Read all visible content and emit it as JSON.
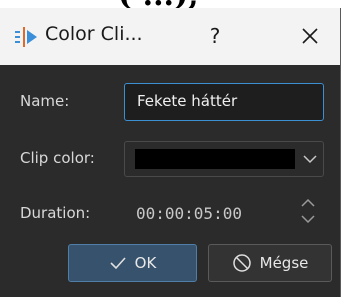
{
  "background_top_text": "(·...),",
  "dialog": {
    "title": "Color Cli...",
    "help_label": "?",
    "close_label": "✕"
  },
  "form": {
    "name_label": "Name:",
    "name_value": "Fekete háttér",
    "clip_color_label": "Clip color:",
    "clip_color_value": "#000000",
    "duration_label": "Duration:",
    "duration_value": "00:00:05:00"
  },
  "buttons": {
    "ok_label": "OK",
    "cancel_label": "Mégse"
  },
  "colors": {
    "accent": "#3c8fd0",
    "dialog_bg": "#2b2b2b",
    "titlebar_bg": "#f3f3f3",
    "ok_bg": "#36526c"
  }
}
